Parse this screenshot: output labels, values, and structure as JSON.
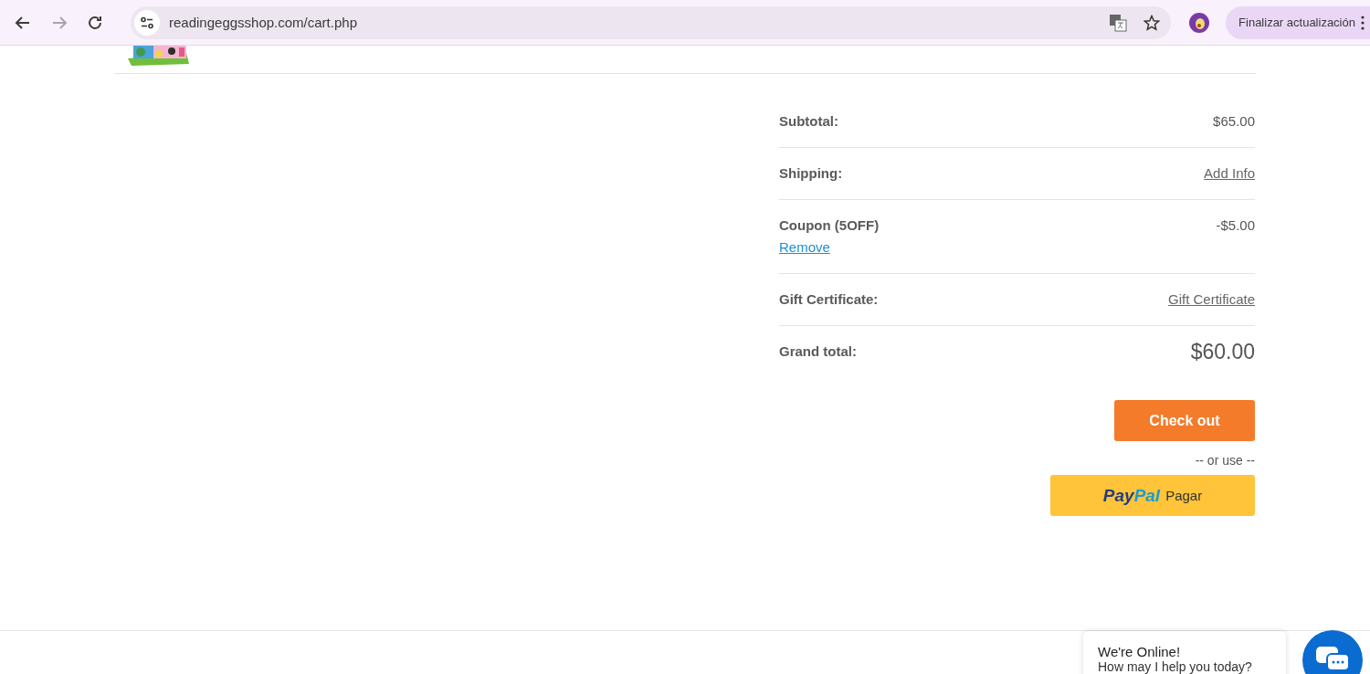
{
  "browser": {
    "url": "readingeggsshop.com/cart.php",
    "update_button": "Finalizar actualización",
    "back_enabled": true,
    "forward_enabled": false
  },
  "summary": {
    "rows": [
      {
        "kind": "text",
        "label": "Subtotal:",
        "value": "$65.00"
      },
      {
        "kind": "link",
        "label": "Shipping:",
        "value": "Add Info"
      },
      {
        "kind": "coupon",
        "label": "Coupon (5OFF)",
        "value": "-$5.00",
        "action": "Remove"
      },
      {
        "kind": "link",
        "label": "Gift Certificate:",
        "value": "Gift Certificate"
      },
      {
        "kind": "total",
        "label": "Grand total:",
        "value": "$60.00"
      }
    ]
  },
  "checkout_button": "Check out",
  "separator": "-- or use --",
  "paypal_button": {
    "brand_first": "Pay",
    "brand_second": "Pal",
    "label": "Pagar"
  },
  "chat_widget": {
    "title": "We're Online!",
    "message": "How may I help you today?"
  }
}
